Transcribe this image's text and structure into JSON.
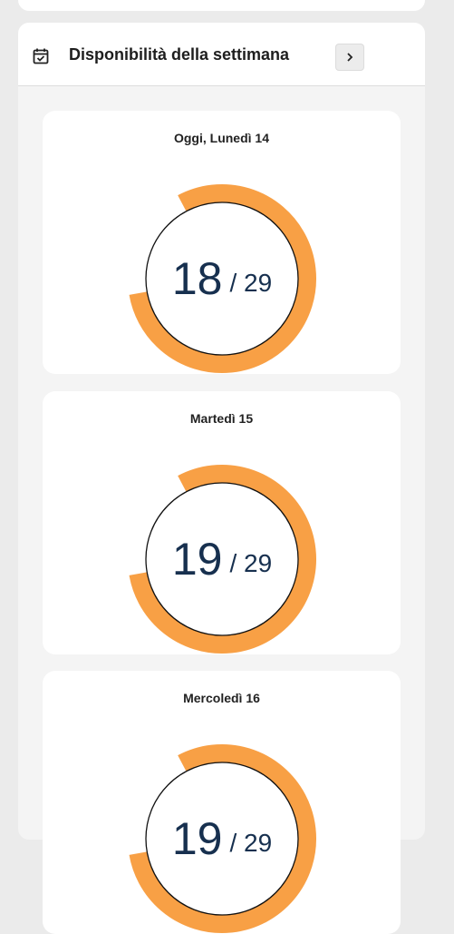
{
  "panel": {
    "title": "Disponibilità della settimana",
    "icon": "calendar-check-icon",
    "next_icon": "chevron-right-icon"
  },
  "colors": {
    "ring": "#f8a045",
    "text": "#17304f"
  },
  "days": [
    {
      "label": "Oggi, Lunedì 14",
      "available": "18",
      "total": "29",
      "sep": "/"
    },
    {
      "label": "Martedì 15",
      "available": "19",
      "total": "29",
      "sep": "/"
    },
    {
      "label": "Mercoledì 16",
      "available": "19",
      "total": "29",
      "sep": "/"
    }
  ]
}
